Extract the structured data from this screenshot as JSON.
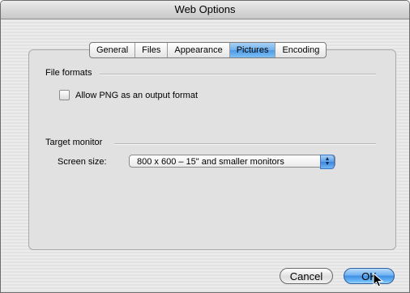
{
  "window": {
    "title": "Web Options"
  },
  "tabs": [
    {
      "label": "General",
      "selected": false
    },
    {
      "label": "Files",
      "selected": false
    },
    {
      "label": "Appearance",
      "selected": false
    },
    {
      "label": "Pictures",
      "selected": true
    },
    {
      "label": "Encoding",
      "selected": false
    }
  ],
  "file_formats": {
    "heading": "File formats",
    "allow_png_label": "Allow PNG as an output format",
    "allow_png_checked": false
  },
  "target_monitor": {
    "heading": "Target monitor",
    "screen_size_label": "Screen size:",
    "screen_size_value": "800 x 600 – 15\" and smaller monitors"
  },
  "buttons": {
    "cancel": "Cancel",
    "ok": "OK"
  },
  "icons": {
    "popup_arrows": "up-down-arrows-icon",
    "cursor": "mouse-pointer-icon"
  },
  "colors": {
    "selected_tab": "#6fb0ee",
    "default_button": "#3f8fe4"
  }
}
